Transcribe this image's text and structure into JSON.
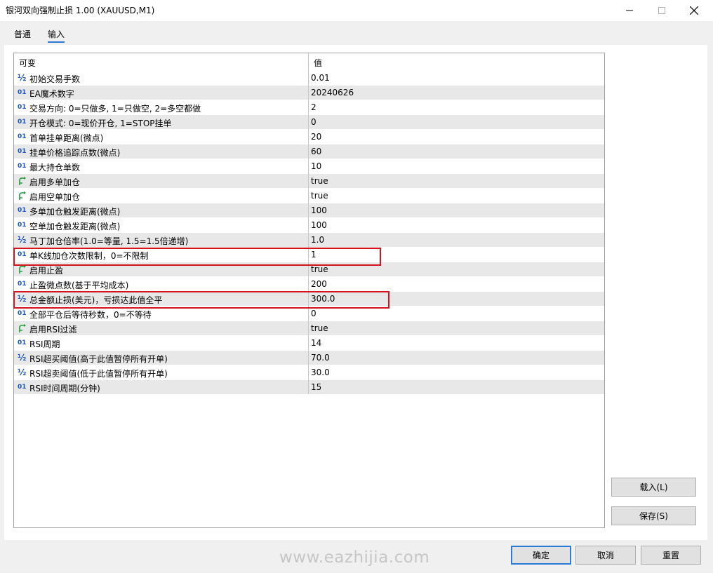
{
  "window": {
    "title": "银河双向强制止损 1.00 (XAUUSD,M1)"
  },
  "tabs": [
    {
      "label": "普通"
    },
    {
      "label": "输入"
    }
  ],
  "grid": {
    "headers": {
      "name": "可变",
      "value": "值"
    },
    "rows": [
      {
        "type": "double",
        "icon_text": "½",
        "name": "初始交易手数",
        "value": "0.01"
      },
      {
        "type": "int",
        "icon_text": "01",
        "name": "EA魔术数字",
        "value": "20240626"
      },
      {
        "type": "int",
        "icon_text": "01",
        "name": "交易方向: 0=只做多, 1=只做空, 2=多空都做",
        "value": "2"
      },
      {
        "type": "int",
        "icon_text": "01",
        "name": "开仓模式: 0=现价开仓, 1=STOP挂单",
        "value": "0"
      },
      {
        "type": "int",
        "icon_text": "01",
        "name": "首单挂单距离(微点)",
        "value": "20"
      },
      {
        "type": "int",
        "icon_text": "01",
        "name": "挂单价格追踪点数(微点)",
        "value": "60"
      },
      {
        "type": "int",
        "icon_text": "01",
        "name": "最大持仓单数",
        "value": "10"
      },
      {
        "type": "bool",
        "icon_text": "",
        "name": "启用多单加仓",
        "value": "true"
      },
      {
        "type": "bool",
        "icon_text": "",
        "name": "启用空单加仓",
        "value": "true"
      },
      {
        "type": "int",
        "icon_text": "01",
        "name": "多单加仓触发距离(微点)",
        "value": "100"
      },
      {
        "type": "int",
        "icon_text": "01",
        "name": "空单加仓触发距离(微点)",
        "value": "100"
      },
      {
        "type": "double",
        "icon_text": "½",
        "name": "马丁加仓倍率(1.0=等量, 1.5=1.5倍递增)",
        "value": "1.0"
      },
      {
        "type": "int",
        "icon_text": "01",
        "name": "单K线加仓次数限制，0=不限制",
        "value": "1"
      },
      {
        "type": "bool",
        "icon_text": "",
        "name": "启用止盈",
        "value": "true"
      },
      {
        "type": "int",
        "icon_text": "01",
        "name": "止盈微点数(基于平均成本)",
        "value": "200"
      },
      {
        "type": "double",
        "icon_text": "½",
        "name": "总金额止损(美元)，亏损达此值全平",
        "value": "300.0"
      },
      {
        "type": "int",
        "icon_text": "01",
        "name": "全部平仓后等待秒数，0=不等待",
        "value": "0"
      },
      {
        "type": "bool",
        "icon_text": "",
        "name": "启用RSI过滤",
        "value": "true"
      },
      {
        "type": "int",
        "icon_text": "01",
        "name": "RSI周期",
        "value": "14"
      },
      {
        "type": "double",
        "icon_text": "½",
        "name": "RSI超买阈值(高于此值暂停所有开单)",
        "value": "70.0"
      },
      {
        "type": "double",
        "icon_text": "½",
        "name": "RSI超卖阈值(低于此值暂停所有开单)",
        "value": "30.0"
      },
      {
        "type": "int",
        "icon_text": "01",
        "name": "RSI时间周期(分钟)",
        "value": "15"
      }
    ]
  },
  "side_buttons": {
    "load": "载入(L)",
    "save": "保存(S)"
  },
  "bottom_buttons": {
    "ok": "确定",
    "cancel": "取消",
    "reset": "重置"
  },
  "watermark": "www.eazhijia.com",
  "colors": {
    "accent": "#2a7ad6",
    "highlight_box": "#d4141c",
    "int_icon": "#1a56c8",
    "bool_icon": "#1e9a3a",
    "alt_row": "#e8e8e8"
  }
}
